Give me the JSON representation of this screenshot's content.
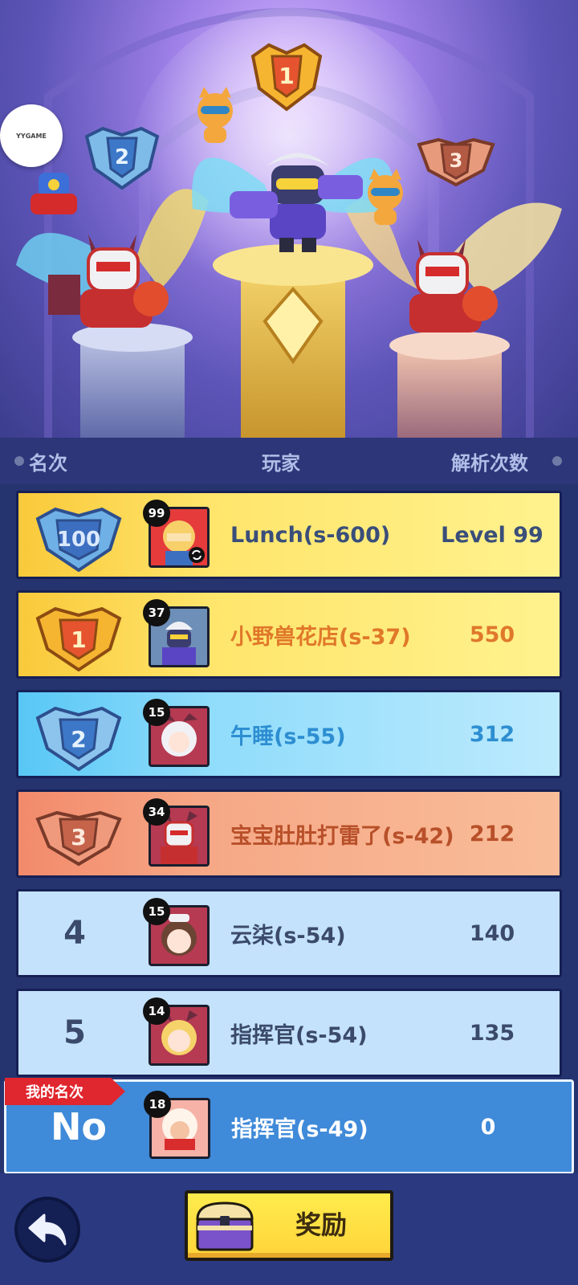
{
  "logo_text": "YYGAME",
  "header": {
    "rank": "名次",
    "player": "玩家",
    "count": "解析次数"
  },
  "rows": [
    {
      "rank_badge": "100",
      "level": "99",
      "name": "Lunch(s-600)",
      "count": "Level 99",
      "style": "gold",
      "name_color": "#3a4e7a",
      "count_color": "#3a4e7a"
    },
    {
      "rank_badge": "1",
      "level": "37",
      "name": "小野兽花店(s-37)",
      "count": "550",
      "style": "gold",
      "name_color": "#e0782a",
      "count_color": "#e0782a"
    },
    {
      "rank_badge": "2",
      "level": "15",
      "name": "午睡(s-55)",
      "count": "312",
      "style": "silver",
      "name_color": "#2d8ed1",
      "count_color": "#2d8ed1"
    },
    {
      "rank_badge": "3",
      "level": "34",
      "name": "宝宝肚肚打雷了(s-42)",
      "count": "212",
      "style": "bronze",
      "name_color": "#b8502a",
      "count_color": "#b8502a"
    },
    {
      "rank": "4",
      "level": "15",
      "name": "云柒(s-54)",
      "count": "140",
      "style": "plain",
      "name_color": "#3b4a6b",
      "count_color": "#3b4a6b"
    },
    {
      "rank": "5",
      "level": "14",
      "name": "指挥官(s-54)",
      "count": "135",
      "style": "plain",
      "name_color": "#3b4a6b",
      "count_color": "#3b4a6b"
    }
  ],
  "mine": {
    "tag": "我的名次",
    "rank": "No",
    "level": "18",
    "name": "指挥官(s-49)",
    "count": "0"
  },
  "footer": {
    "reward_label": "奖励"
  },
  "podium_badges": [
    "1",
    "2",
    "3"
  ],
  "icons": [
    "back-arrow-icon",
    "treasure-chest-icon",
    "sync-icon"
  ]
}
